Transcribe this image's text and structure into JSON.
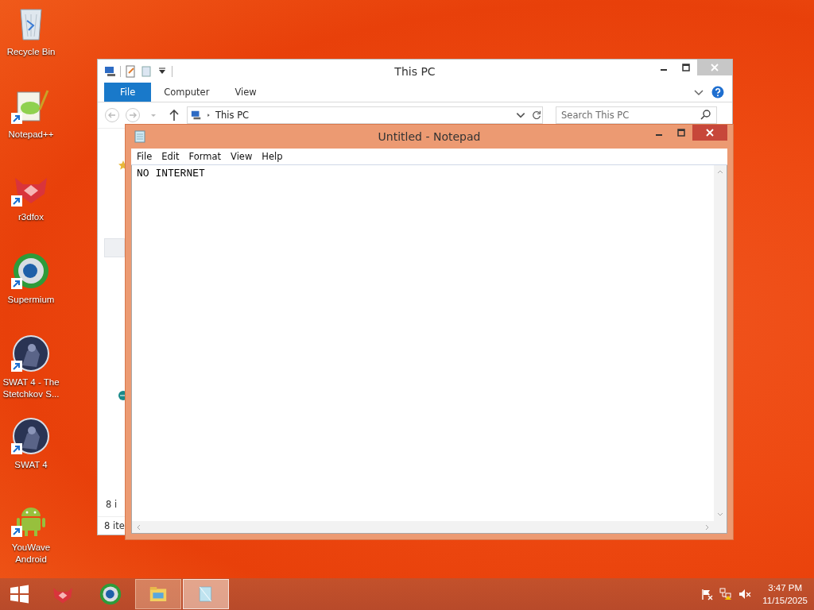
{
  "desktop_icons": [
    {
      "label": "Recycle Bin",
      "kind": "recycle",
      "shortcut": false
    },
    {
      "label": "Notepad++",
      "kind": "notepadpp",
      "shortcut": true
    },
    {
      "label": "r3dfox",
      "kind": "fox",
      "shortcut": true
    },
    {
      "label": "Supermium",
      "kind": "globe",
      "shortcut": true
    },
    {
      "label": "SWAT 4 - The Stetchkov S...",
      "kind": "swat",
      "shortcut": true
    },
    {
      "label": "SWAT 4",
      "kind": "swat",
      "shortcut": true
    },
    {
      "label": "YouWave Android",
      "kind": "android",
      "shortcut": true
    }
  ],
  "explorer": {
    "title": "This PC",
    "ribbon_tabs": [
      {
        "label": "File",
        "selected": true
      },
      {
        "label": "Computer",
        "selected": false
      },
      {
        "label": "View",
        "selected": false
      }
    ],
    "address": "This PC",
    "search": {
      "placeholder": "Search This PC"
    },
    "pane_text": "8 i",
    "status_bar": "8 ite"
  },
  "notepad": {
    "title": "Untitled - Notepad",
    "menu": [
      "File",
      "Edit",
      "Format",
      "View",
      "Help"
    ],
    "text": "NO INTERNET"
  },
  "taskbar": {
    "items": [
      {
        "kind": "fox",
        "selected": false
      },
      {
        "kind": "globe",
        "selected": false
      },
      {
        "kind": "explorer",
        "selected": false
      },
      {
        "kind": "notepad",
        "selected": true
      }
    ],
    "time": "3:47 PM",
    "date": "11/15/2025"
  }
}
